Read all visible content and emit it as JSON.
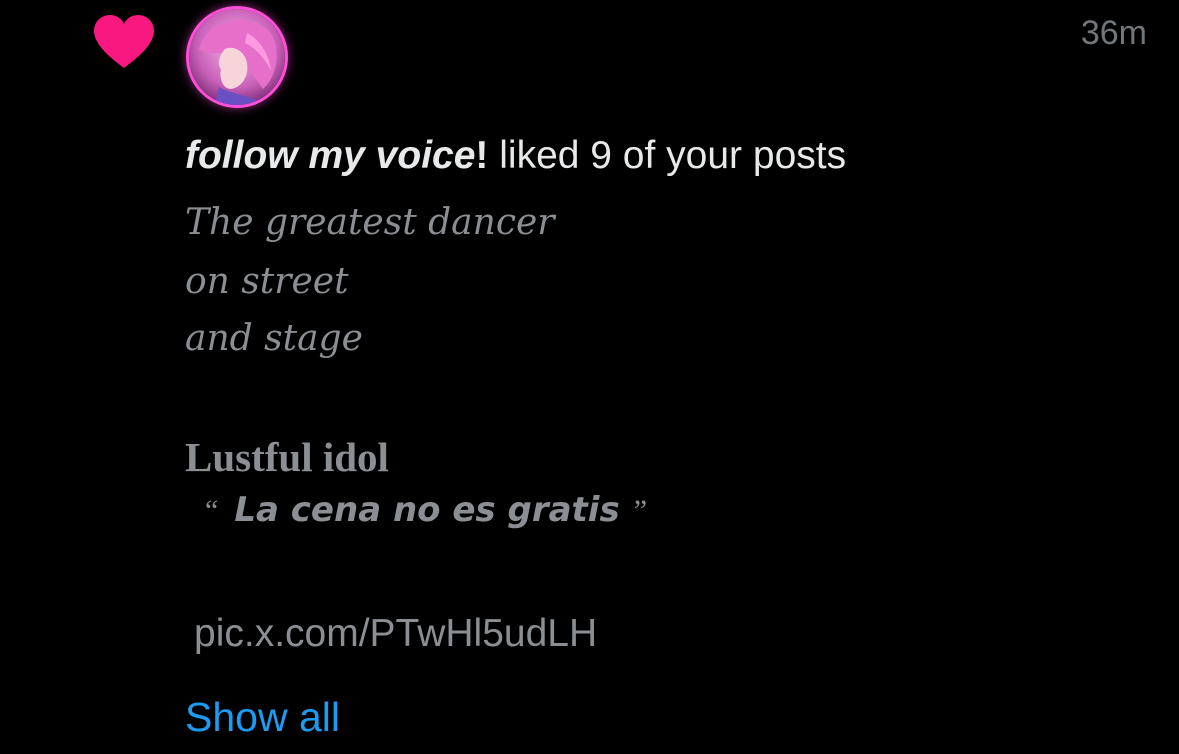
{
  "notification": {
    "icon": "heart-icon",
    "icon_color": "#f91880",
    "avatar": "user-avatar",
    "timestamp": "36m",
    "user_name": "follow my voice",
    "user_name_suffix": "!",
    "action_text": " liked 9 of your posts",
    "post_lines": [
      "The greatest dancer",
      "on street",
      "and stage"
    ],
    "post_title": "Lustful idol",
    "quote_open": "“",
    "quote_text": "La cena no es gratis",
    "quote_close": "”",
    "link_text": "pic.x.com/PTwHl5udLH",
    "show_all_label": "Show all",
    "link_color": "#1d9bf0"
  }
}
